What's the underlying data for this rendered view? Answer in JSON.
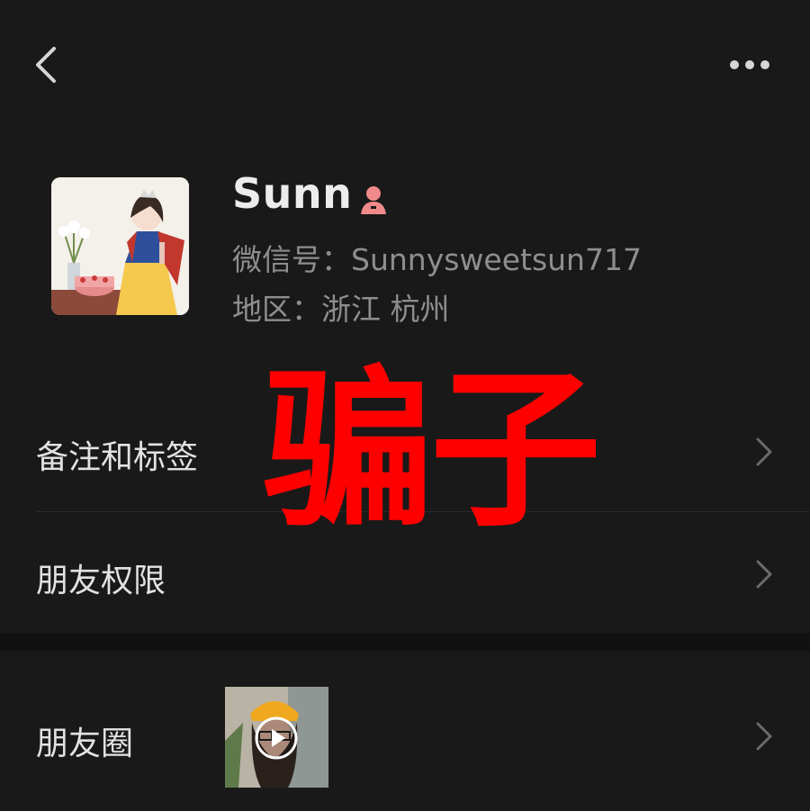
{
  "topbar": {
    "back_icon": "chevron-left-icon",
    "more_icon": "more-dots-icon"
  },
  "profile": {
    "name": "Sunn",
    "gender_icon": "female-icon",
    "gender_color": "#f08a8a",
    "wechat_id_label": "微信号：Sunnysweetsun717",
    "region_label": "地区：浙江 杭州"
  },
  "menu": {
    "remarks_tags": "备注和标签",
    "friend_permissions": "朋友权限",
    "moments": "朋友圈"
  },
  "watermark": {
    "text": "骗子",
    "color": "#ff0000"
  }
}
